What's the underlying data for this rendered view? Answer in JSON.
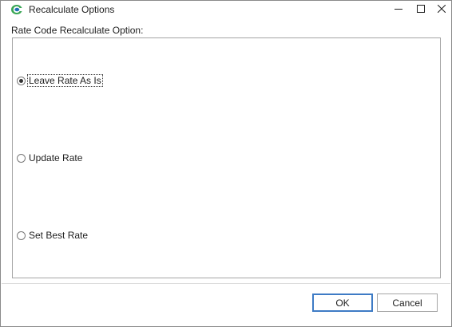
{
  "window": {
    "title": "Recalculate Options",
    "controls": {
      "minimize": "minimize-icon",
      "maximize": "maximize-icon",
      "close": "close-icon"
    }
  },
  "group": {
    "label": "Rate Code Recalculate Option:",
    "options": [
      {
        "label": "Leave Rate As Is",
        "selected": true
      },
      {
        "label": "Update Rate",
        "selected": false
      },
      {
        "label": "Set Best Rate",
        "selected": false
      }
    ]
  },
  "buttons": {
    "ok_label": "OK",
    "cancel_label": "Cancel"
  },
  "colors": {
    "focus_border": "#3e7bc5",
    "icon_green": "#3aa655",
    "icon_blue": "#1f6fb5"
  }
}
